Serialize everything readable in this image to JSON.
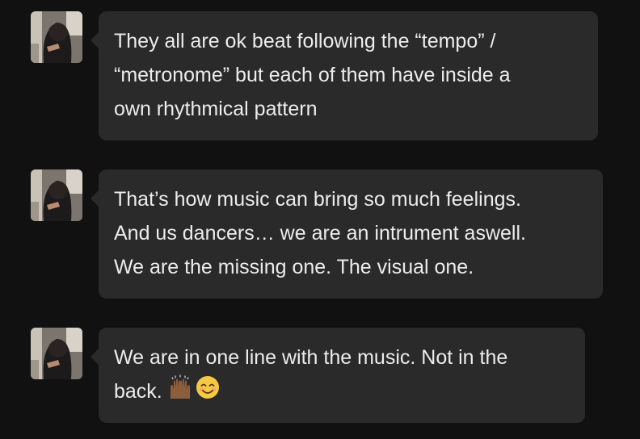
{
  "messages": [
    {
      "lines": [
        "They all are ok beat following the “tempo” /",
        "“metronome” but each of them have inside a",
        "own rhythmical pattern"
      ]
    },
    {
      "lines": [
        "That’s how music can bring so much feelings.",
        "And us dancers… we are an intrument aswell.",
        "We are the missing one. The visual one."
      ]
    },
    {
      "lines": [
        "We are in one line with the music. Not in the",
        "back."
      ],
      "emojis": [
        "raised-hands-icon",
        "smiling-face-icon"
      ]
    }
  ],
  "colors": {
    "background": "#111111",
    "bubble": "#2a2a2a",
    "text": "#ececec"
  }
}
